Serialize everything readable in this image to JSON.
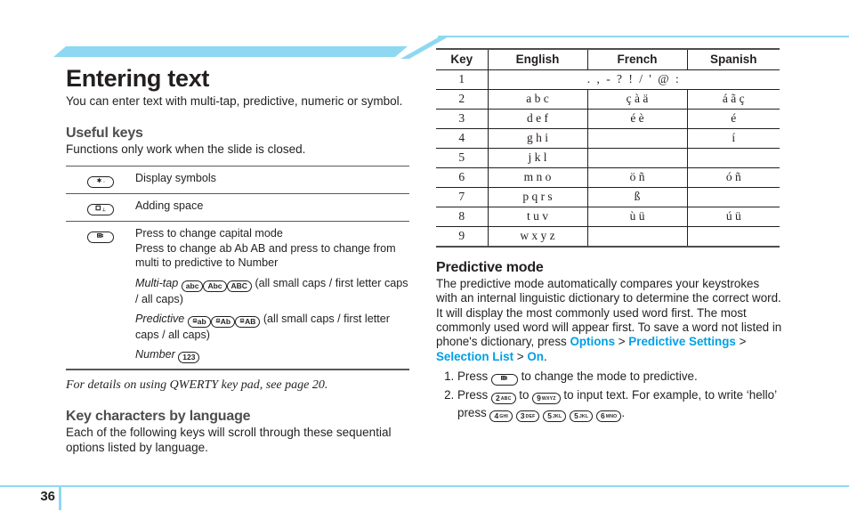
{
  "colors": {
    "accent": "#8fd8f2",
    "link": "#00a0e3",
    "ink": "#231f20",
    "gray": "#4d4d4f"
  },
  "page": {
    "title": "Entering text",
    "lede": "You can enter text with multi-tap, predictive, numeric or symbol.",
    "folio": "36"
  },
  "useful_keys": {
    "heading": "Useful keys",
    "subtitle": "Functions only work when the slide is closed.",
    "rows": [
      {
        "key_icon": "star-key",
        "key_label": "*",
        "key_sub": "+",
        "desc": "Display symbols"
      },
      {
        "key_icon": "zero-space-key",
        "key_label": "0",
        "key_sub": "space",
        "desc": "Adding space"
      }
    ],
    "mode_row": {
      "key_icon": "mode-change-key",
      "line1": "Press to change capital mode",
      "line2": "Press to change ab Ab AB and press to change from multi to predictive to Number",
      "multitap_label": "Multi-tap",
      "multitap_keys": [
        "abc",
        "Abc",
        "ABC"
      ],
      "multitap_note": "(all small caps / first letter caps / all caps)",
      "predictive_label": "Predictive",
      "predictive_keys": [
        "ab",
        "Ab",
        "AB"
      ],
      "predictive_note": "(all small caps / first letter caps / all caps)",
      "number_label": "Number",
      "number_key": "123"
    },
    "note": "For details on using QWERTY key pad, see page 20."
  },
  "key_characters": {
    "heading": "Key characters by language",
    "subtitle": "Each of the following keys will scroll through these sequential options listed by language."
  },
  "lang_table": {
    "headers": [
      "Key",
      "English",
      "French",
      "Spanish"
    ],
    "row1_span": ". , - ? ! / ' @ :",
    "rows": [
      {
        "key": "1",
        "span": ". , - ? ! / ' @ :"
      },
      {
        "key": "2",
        "english": "a b c",
        "french": "ç  à  ä",
        "spanish": "á  ã  ç"
      },
      {
        "key": "3",
        "english": "d e f",
        "french": "é  è",
        "spanish": "é"
      },
      {
        "key": "4",
        "english": "g h i",
        "french": "",
        "spanish": "í"
      },
      {
        "key": "5",
        "english": "j k l",
        "french": "",
        "spanish": ""
      },
      {
        "key": "6",
        "english": "m n o",
        "french": "ö  ñ",
        "spanish": "ó  ñ"
      },
      {
        "key": "7",
        "english": "p q r s",
        "french": "ß",
        "spanish": ""
      },
      {
        "key": "8",
        "english": "t u v",
        "french": "ù  ü",
        "spanish": "ú  ü"
      },
      {
        "key": "9",
        "english": "w x y z",
        "french": "",
        "spanish": ""
      }
    ]
  },
  "predictive": {
    "heading": "Predictive mode",
    "body_1": "The predictive mode automatically compares your keystrokes with an internal linguistic dictionary to determine the correct word. It will display the most commonly used word first. The most commonly used word will appear first. To save a word not listed in phone's dictionary, press ",
    "link_options": "Options",
    "link_predictive_settings": "Predictive Settings",
    "link_selection_list": "Selection List",
    "link_on": "On",
    "sep": " > ",
    "period": ".",
    "step1_a": "Press ",
    "step1_b": " to change the mode to predictive.",
    "step1_key": "mode-change-key",
    "step2_a": "Press ",
    "step2_b": " to ",
    "step2_c": " to input text. For example, to write ‘hello’ press ",
    "step2_d": ".",
    "step2_key_from": {
      "digit": "2",
      "letters": "ABC"
    },
    "step2_key_to": {
      "digit": "9",
      "letters": "WXYZ"
    },
    "hello_keys": [
      {
        "digit": "4",
        "letters": "GHI"
      },
      {
        "digit": "3",
        "letters": "DEF"
      },
      {
        "digit": "5",
        "letters": "JKL"
      },
      {
        "digit": "5",
        "letters": "JKL"
      },
      {
        "digit": "6",
        "letters": "MNO"
      }
    ]
  }
}
